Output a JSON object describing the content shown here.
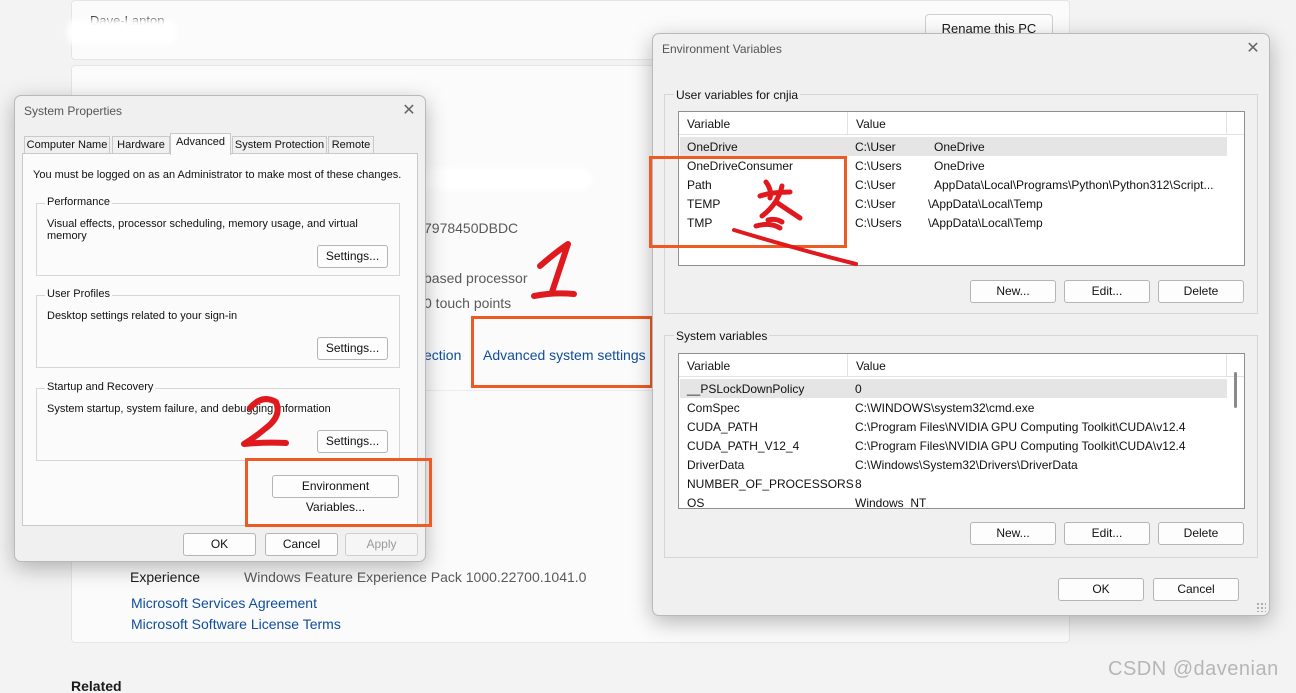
{
  "settings_bg": {
    "pc_name": "Dave-Laptop",
    "rename_button": "Rename this PC",
    "lines": {
      "id_partial": "7978450DBDC",
      "processor_partial": "based processor",
      "touch_partial": "0 touch points",
      "protection_partial": "ection"
    },
    "advanced_link": "Advanced system settings",
    "experience_label": "Experience",
    "experience_value": "Windows Feature Experience Pack 1000.22700.1041.0",
    "services_link": "Microsoft Services Agreement",
    "license_link": "Microsoft Software License Terms",
    "related_heading": "Related"
  },
  "system_properties": {
    "title": "System Properties",
    "tabs": [
      "Computer Name",
      "Hardware",
      "Advanced",
      "System Protection",
      "Remote"
    ],
    "active_tab": "Advanced",
    "admin_note": "You must be logged on as an Administrator to make most of these changes.",
    "performance": {
      "label": "Performance",
      "desc": "Visual effects, processor scheduling, memory usage, and virtual memory",
      "button": "Settings..."
    },
    "user_profiles": {
      "label": "User Profiles",
      "desc": "Desktop settings related to your sign-in",
      "button": "Settings..."
    },
    "startup_recovery": {
      "label": "Startup and Recovery",
      "desc": "System startup, system failure, and debugging information",
      "button": "Settings..."
    },
    "env_button": "Environment Variables...",
    "ok": "OK",
    "cancel": "Cancel",
    "apply": "Apply"
  },
  "environment_variables": {
    "title": "Environment Variables",
    "user_section_label": "User variables for cnjia",
    "system_section_label": "System variables",
    "col_variable": "Variable",
    "col_value": "Value",
    "user_rows": [
      {
        "variable": "OneDrive",
        "value": "C:\\User",
        "value_tail": "OneDrive"
      },
      {
        "variable": "OneDriveConsumer",
        "value": "C:\\Users",
        "value_tail": "OneDrive"
      },
      {
        "variable": "Path",
        "value": "C:\\User",
        "value_tail": "AppData\\Local\\Programs\\Python\\Python312\\Script..."
      },
      {
        "variable": "TEMP",
        "value": "C:\\User",
        "value_tail": "\\AppData\\Local\\Temp"
      },
      {
        "variable": "TMP",
        "value": "C:\\Users",
        "value_tail": "\\AppData\\Local\\Temp"
      }
    ],
    "system_rows": [
      {
        "variable": "__PSLockDownPolicy",
        "value": "0"
      },
      {
        "variable": "ComSpec",
        "value": "C:\\WINDOWS\\system32\\cmd.exe"
      },
      {
        "variable": "CUDA_PATH",
        "value": "C:\\Program Files\\NVIDIA GPU Computing Toolkit\\CUDA\\v12.4"
      },
      {
        "variable": "CUDA_PATH_V12_4",
        "value": "C:\\Program Files\\NVIDIA GPU Computing Toolkit\\CUDA\\v12.4"
      },
      {
        "variable": "DriverData",
        "value": "C:\\Windows\\System32\\Drivers\\DriverData"
      },
      {
        "variable": "NUMBER_OF_PROCESSORS",
        "value": "8"
      },
      {
        "variable": "OS",
        "value": "Windows_NT"
      }
    ],
    "new_button": "New...",
    "edit_button": "Edit...",
    "delete_button": "Delete",
    "ok": "OK",
    "cancel": "Cancel"
  },
  "annotations": {
    "step1": "1",
    "step2": "2",
    "step3": "3",
    "highlight_color": "#ee5a24",
    "ink_color": "#e0191e"
  },
  "watermark": "CSDN @davenian"
}
